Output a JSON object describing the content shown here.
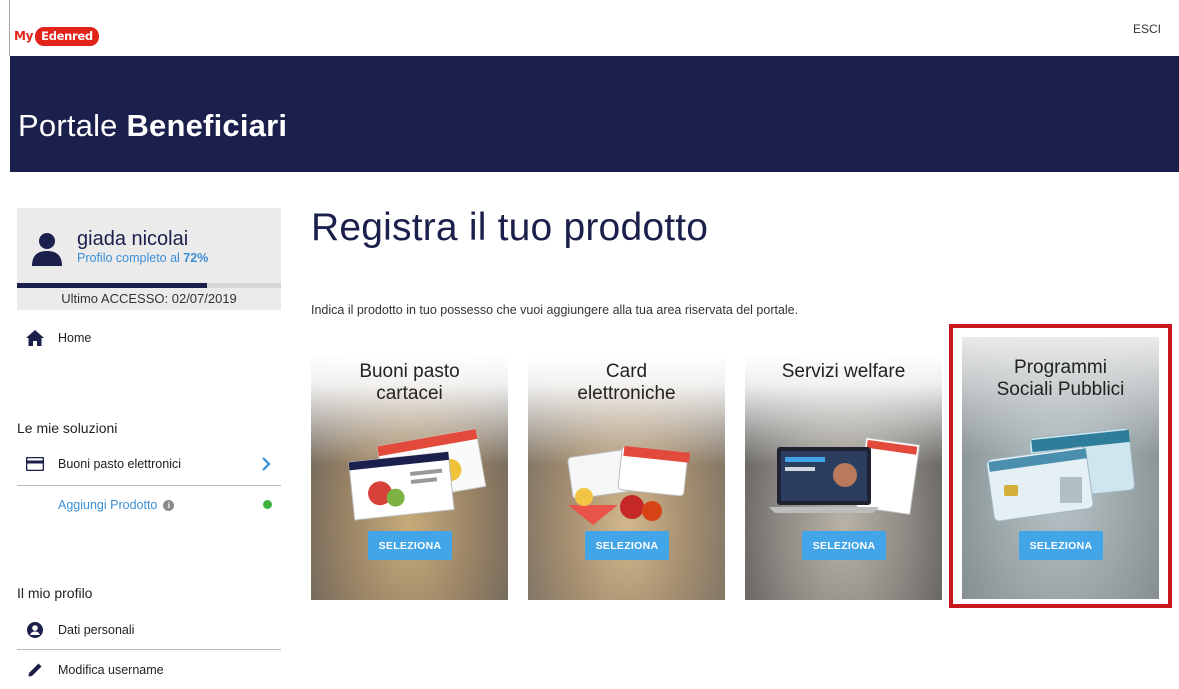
{
  "header": {
    "logo_my": "My",
    "logo_brand": "Edenred",
    "logout_label": "ESCI"
  },
  "banner": {
    "title_light": "Portale ",
    "title_bold": "Beneficiari"
  },
  "profile": {
    "name": "giada nicolai",
    "completion_prefix": "Profilo completo al ",
    "completion_value": "72%",
    "completion_fraction": 0.72,
    "last_access": "Ultimo ACCESSO: 02/07/2019"
  },
  "sidebar": {
    "home_label": "Home",
    "solutions_heading": "Le mie soluzioni",
    "solutions": [
      {
        "label": "Buoni pasto elettronici",
        "icon": "card-icon"
      },
      {
        "label": "Aggiungi Prodotto",
        "icon": "info-icon"
      }
    ],
    "profile_heading": "Il mio profilo",
    "profile_items": [
      {
        "label": "Dati personali",
        "icon": "user-circle-icon"
      },
      {
        "label": "Modifica username",
        "icon": "pencil-icon"
      }
    ]
  },
  "main": {
    "title": "Registra il tuo prodotto",
    "description": "Indica il prodotto in tuo possesso che vuoi aggiungere alla tua area riservata del portale.",
    "cards": [
      {
        "title_line1": "Buoni pasto",
        "title_line2": "cartacei",
        "button": "SELEZIONA"
      },
      {
        "title_line1": "Card",
        "title_line2": "elettroniche",
        "button": "SELEZIONA"
      },
      {
        "title_line1": "Servizi welfare",
        "title_line2": "",
        "button": "SELEZIONA"
      },
      {
        "title_line1": "Programmi",
        "title_line2": "Sociali Pubblici",
        "button": "SELEZIONA"
      }
    ]
  },
  "colors": {
    "navy": "#1b1f4b",
    "accent_blue": "#42a5e8",
    "brand_red": "#e2231a",
    "highlight_red": "#c9161c",
    "status_green": "#3db33d"
  }
}
